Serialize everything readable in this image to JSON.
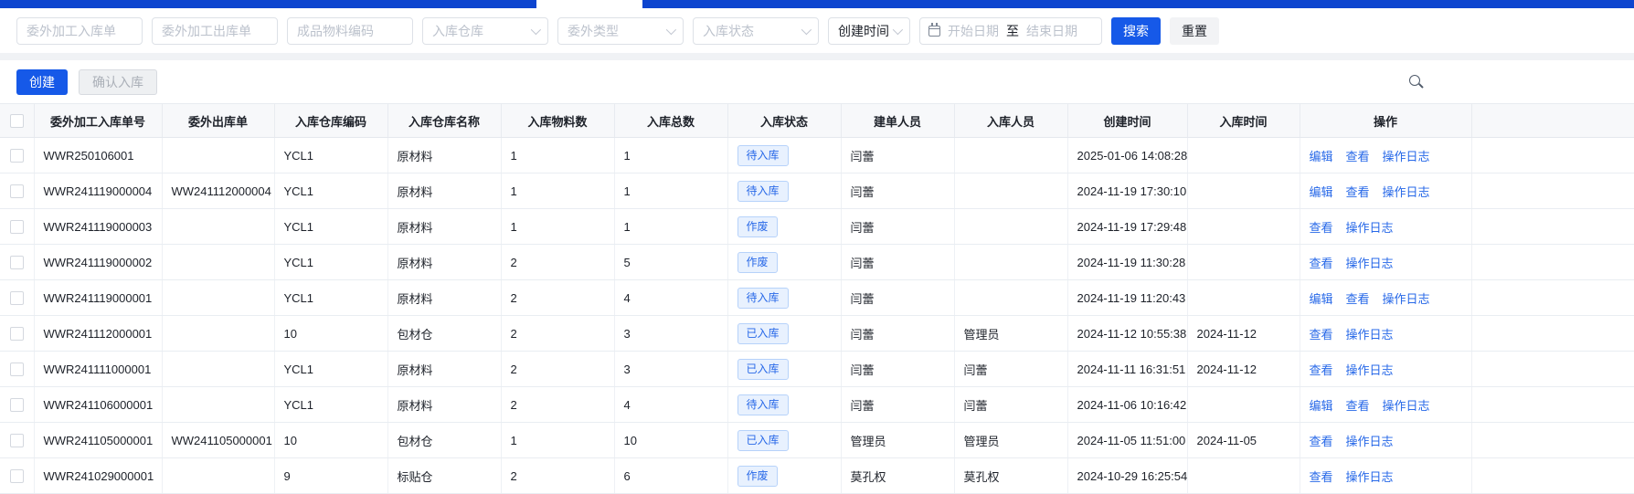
{
  "colors": {
    "topbar_blue": "#0d45cf",
    "primary_blue": "#1659e8",
    "link_blue": "#2768e8",
    "badge_bg": "#e8f1fe",
    "badge_border": "#b6d2fa",
    "table_header_bg": "#f7f8fa"
  },
  "icons": {
    "select_arrow": "chevron-down",
    "date_picker": "calendar",
    "toolbar_search": "magnifier"
  },
  "filters": {
    "inbound_order_placeholder": "委外加工入库单",
    "outbound_order_placeholder": "委外加工出库单",
    "material_code_placeholder": "成品物料编码",
    "warehouse_placeholder": "入库仓库",
    "outsource_type_placeholder": "委外类型",
    "inbound_status_placeholder": "入库状态",
    "time_field_value": "创建时间",
    "date_start_placeholder": "开始日期",
    "date_separator": "至",
    "date_end_placeholder": "结束日期",
    "search_label": "搜索",
    "reset_label": "重置"
  },
  "toolbar": {
    "create_label": "创建",
    "confirm_inbound_label": "确认入库"
  },
  "table": {
    "columns": [
      "委外加工入库单号",
      "委外出库单",
      "入库仓库编码",
      "入库仓库名称",
      "入库物料数",
      "入库总数",
      "入库状态",
      "建单人员",
      "入库人员",
      "创建时间",
      "入库时间",
      "操作"
    ],
    "rows": [
      {
        "order_no": "WWR250106001",
        "outbound_no": "",
        "warehouse_code": "YCL1",
        "warehouse_name": "原材料",
        "material_count": "1",
        "total_count": "1",
        "status": "待入库",
        "creator": "闫蕾",
        "operator": "",
        "created_at": "2025-01-06 14:08:28",
        "inbound_at": "",
        "actions": [
          "编辑",
          "查看",
          "操作日志"
        ]
      },
      {
        "order_no": "WWR241119000004",
        "outbound_no": "WW241112000004",
        "warehouse_code": "YCL1",
        "warehouse_name": "原材料",
        "material_count": "1",
        "total_count": "1",
        "status": "待入库",
        "creator": "闫蕾",
        "operator": "",
        "created_at": "2024-11-19 17:30:10",
        "inbound_at": "",
        "actions": [
          "编辑",
          "查看",
          "操作日志"
        ]
      },
      {
        "order_no": "WWR241119000003",
        "outbound_no": "",
        "warehouse_code": "YCL1",
        "warehouse_name": "原材料",
        "material_count": "1",
        "total_count": "1",
        "status": "作废",
        "creator": "闫蕾",
        "operator": "",
        "created_at": "2024-11-19 17:29:48",
        "inbound_at": "",
        "actions": [
          "查看",
          "操作日志"
        ]
      },
      {
        "order_no": "WWR241119000002",
        "outbound_no": "",
        "warehouse_code": "YCL1",
        "warehouse_name": "原材料",
        "material_count": "2",
        "total_count": "5",
        "status": "作废",
        "creator": "闫蕾",
        "operator": "",
        "created_at": "2024-11-19 11:30:28",
        "inbound_at": "",
        "actions": [
          "查看",
          "操作日志"
        ]
      },
      {
        "order_no": "WWR241119000001",
        "outbound_no": "",
        "warehouse_code": "YCL1",
        "warehouse_name": "原材料",
        "material_count": "2",
        "total_count": "4",
        "status": "待入库",
        "creator": "闫蕾",
        "operator": "",
        "created_at": "2024-11-19 11:20:43",
        "inbound_at": "",
        "actions": [
          "编辑",
          "查看",
          "操作日志"
        ]
      },
      {
        "order_no": "WWR241112000001",
        "outbound_no": "",
        "warehouse_code": "10",
        "warehouse_name": "包材仓",
        "material_count": "2",
        "total_count": "3",
        "status": "已入库",
        "creator": "闫蕾",
        "operator": "管理员",
        "created_at": "2024-11-12 10:55:38",
        "inbound_at": "2024-11-12",
        "actions": [
          "查看",
          "操作日志"
        ]
      },
      {
        "order_no": "WWR241111000001",
        "outbound_no": "",
        "warehouse_code": "YCL1",
        "warehouse_name": "原材料",
        "material_count": "2",
        "total_count": "3",
        "status": "已入库",
        "creator": "闫蕾",
        "operator": "闫蕾",
        "created_at": "2024-11-11 16:31:51",
        "inbound_at": "2024-11-12",
        "actions": [
          "查看",
          "操作日志"
        ]
      },
      {
        "order_no": "WWR241106000001",
        "outbound_no": "",
        "warehouse_code": "YCL1",
        "warehouse_name": "原材料",
        "material_count": "2",
        "total_count": "4",
        "status": "待入库",
        "creator": "闫蕾",
        "operator": "闫蕾",
        "created_at": "2024-11-06 10:16:42",
        "inbound_at": "",
        "actions": [
          "编辑",
          "查看",
          "操作日志"
        ]
      },
      {
        "order_no": "WWR241105000001",
        "outbound_no": "WW241105000001",
        "warehouse_code": "10",
        "warehouse_name": "包材仓",
        "material_count": "1",
        "total_count": "10",
        "status": "已入库",
        "creator": "管理员",
        "operator": "管理员",
        "created_at": "2024-11-05 11:51:00",
        "inbound_at": "2024-11-05",
        "actions": [
          "查看",
          "操作日志"
        ]
      },
      {
        "order_no": "WWR241029000001",
        "outbound_no": "",
        "warehouse_code": "9",
        "warehouse_name": "标贴仓",
        "material_count": "2",
        "total_count": "6",
        "status": "作废",
        "creator": "莫孔权",
        "operator": "莫孔权",
        "created_at": "2024-10-29 16:25:54",
        "inbound_at": "",
        "actions": [
          "查看",
          "操作日志"
        ]
      }
    ]
  }
}
